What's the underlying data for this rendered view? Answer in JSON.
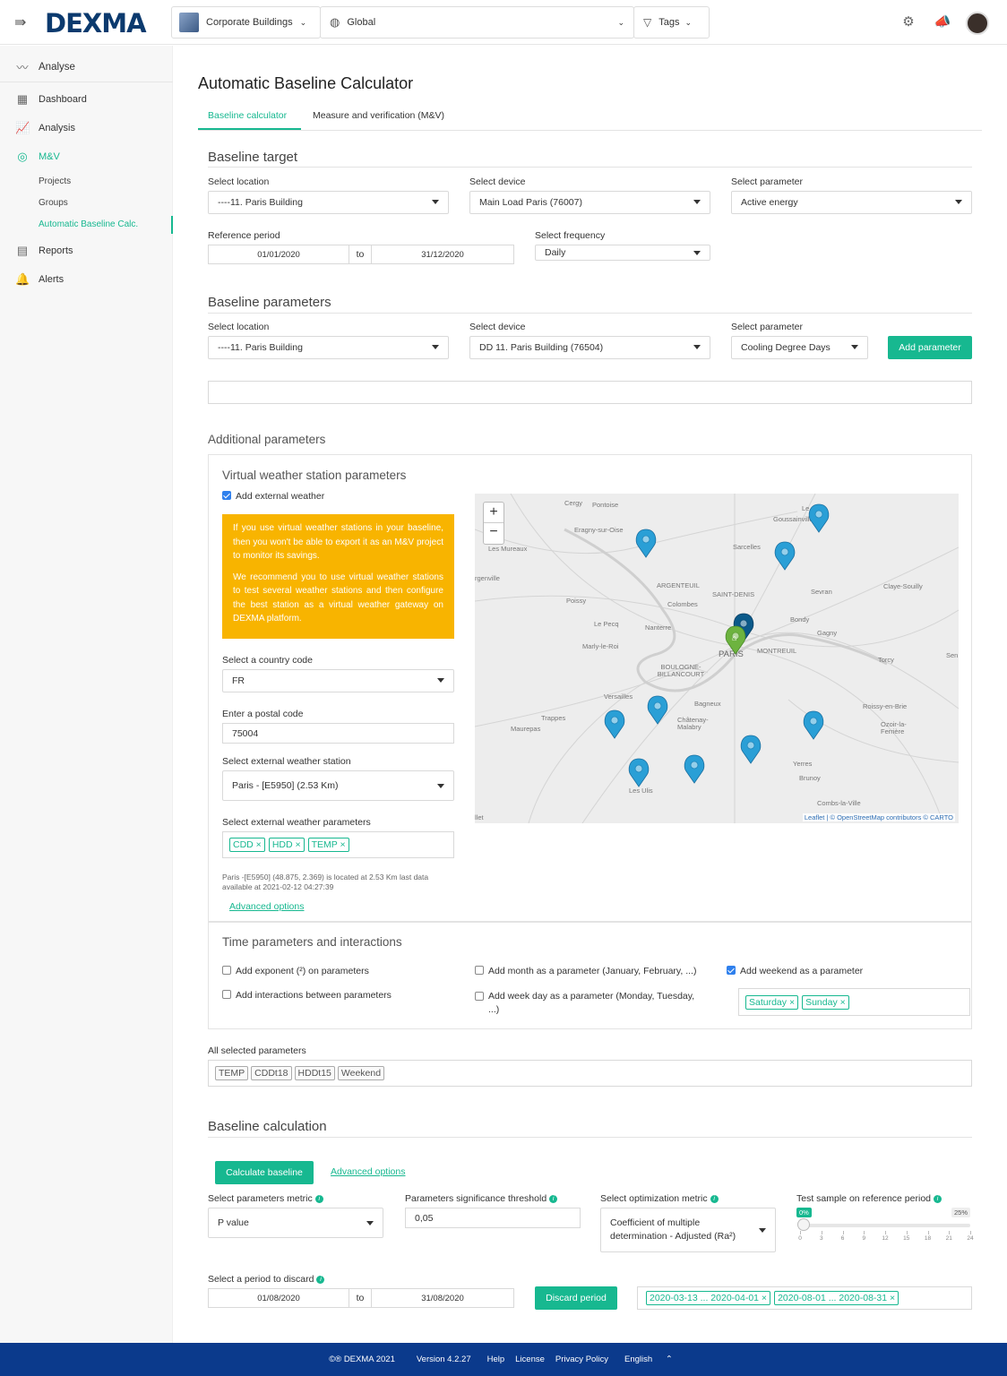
{
  "header": {
    "logo": "DEXMA",
    "org_selector": "Corporate Buildings",
    "scope_selector": "Global",
    "tags_label": "Tags"
  },
  "sidebar": {
    "section": "Analyse",
    "items": [
      {
        "label": "Dashboard",
        "icon": "dashboard-icon"
      },
      {
        "label": "Analysis",
        "icon": "analysis-icon"
      },
      {
        "label": "M&V",
        "icon": "mv-icon"
      },
      {
        "label": "Reports",
        "icon": "reports-icon"
      },
      {
        "label": "Alerts",
        "icon": "alerts-icon"
      }
    ],
    "sub_items": [
      "Projects",
      "Groups",
      "Automatic Baseline Calc."
    ]
  },
  "page": {
    "title": "Automatic Baseline Calculator",
    "tabs": [
      "Baseline calculator",
      "Measure and verification (M&V)"
    ]
  },
  "baseline_target": {
    "heading": "Baseline target",
    "location_label": "Select location",
    "location_value": "----11. Paris Building",
    "device_label": "Select device",
    "device_value": "Main Load Paris (76007)",
    "parameter_label": "Select parameter",
    "parameter_value": "Active energy",
    "period_label": "Reference period",
    "period_from": "01/01/2020",
    "period_to_label": "to",
    "period_to": "31/12/2020",
    "frequency_label": "Select frequency",
    "frequency_value": "Daily"
  },
  "baseline_parameters": {
    "heading": "Baseline parameters",
    "location_label": "Select location",
    "location_value": "----11. Paris Building",
    "device_label": "Select device",
    "device_value": "DD 11. Paris Building (76504)",
    "parameter_label": "Select parameter",
    "parameter_value": "Cooling Degree Days",
    "add_button": "Add parameter"
  },
  "additional": {
    "heading": "Additional parameters",
    "vws_heading": "Virtual weather station parameters",
    "add_external_weather": "Add external weather",
    "warning_p1": "If you use virtual weather stations in your baseline, then you won't be able to export it as an M&V project to monitor its savings.",
    "warning_p2": "We recommend you to use virtual weather stations to test several weather stations and then configure the best station as a virtual weather gateway on DEXMA platform.",
    "country_label": "Select a country code",
    "country_value": "FR",
    "postal_label": "Enter a postal code",
    "postal_value": "75004",
    "station_label": "Select external weather station",
    "station_value": "Paris - [E5950] (2.53 Km)",
    "weather_params_label": "Select external weather parameters",
    "weather_params": [
      "CDD",
      "HDD",
      "TEMP"
    ],
    "station_note": "Paris -[E5950] (48.875, 2.369) is located at 2.53 Km last data available at 2021-02-12 04:27:39",
    "advanced_link": "Advanced options",
    "map_attribution": "Leaflet | © OpenStreetMap contributors © CARTO",
    "map_places": [
      "Cergy",
      "Pontoise",
      "Eragny-sur-Oise",
      "Les Mureaux",
      "Sarcelles",
      "Goussainville",
      "ARGENTEUIL",
      "SAINT-DENIS",
      "Sevran",
      "Claye-Souilly",
      "Colombes",
      "Bondy",
      "Poissy",
      "Le Pecq",
      "Nanterre",
      "Gagny",
      "Marly-le-Roi",
      "PARIS",
      "MONTREUIL",
      "Torcy",
      "BOULOGNE-BILLANCOURT",
      "Versailles",
      "Bagneux",
      "Roissy-en-Brie",
      "Trappes",
      "Châtenay-Malabry",
      "Ozoir-la-Ferrière",
      "Maurepas",
      "Yerres",
      "Brunoy",
      "Les Ulis",
      "Combs-la-Ville",
      "rgenville",
      "Le",
      "Sen",
      "llet"
    ],
    "time_heading": "Time parameters and interactions",
    "opt_exponent": "Add exponent (²) on parameters",
    "opt_month": "Add month as a parameter (January, February, ...)",
    "opt_weekend": "Add weekend as a parameter",
    "opt_interactions": "Add interactions between parameters",
    "opt_weekday": "Add week day as a parameter (Monday, Tuesday, ...)",
    "weekend_days": [
      "Saturday",
      "Sunday"
    ],
    "all_selected_label": "All selected parameters",
    "all_selected": [
      "TEMP",
      "CDDt18",
      "HDDt15",
      "Weekend"
    ]
  },
  "calculation": {
    "heading": "Baseline calculation",
    "calc_button": "Calculate baseline",
    "advanced_link": "Advanced options",
    "metric_label": "Select parameters metric",
    "metric_value": "P value",
    "threshold_label": "Parameters significance threshold",
    "threshold_value": "0,05",
    "opt_metric_label": "Select optimization metric",
    "opt_metric_value": "Coefficient of multiple determination - Adjusted (Ra²)",
    "test_sample_label": "Test sample on reference period",
    "slider_min_badge": "0%",
    "slider_max_badge": "25%",
    "slider_value": 0,
    "slider_ticks": [
      "0",
      "3",
      "6",
      "9",
      "12",
      "15",
      "18",
      "21",
      "24"
    ],
    "discard_label": "Select a period to discard",
    "discard_from": "01/08/2020",
    "discard_to_label": "to",
    "discard_to": "31/08/2020",
    "discard_button": "Discard period",
    "discarded": [
      "2020-03-13 ... 2020-04-01",
      "2020-08-01 ... 2020-08-31"
    ]
  },
  "footer": {
    "copyright": "©® DEXMA 2021",
    "version": "Version 4.2.27",
    "help": "Help",
    "license": "License",
    "privacy": "Privacy Policy",
    "language": "English"
  },
  "colors": {
    "brand": "#0b3a6e",
    "accent": "#17b890",
    "warning": "#f8b400",
    "footer": "#0b3a8c",
    "marker": "#2a9fd6",
    "home_marker": "#6db33f"
  }
}
